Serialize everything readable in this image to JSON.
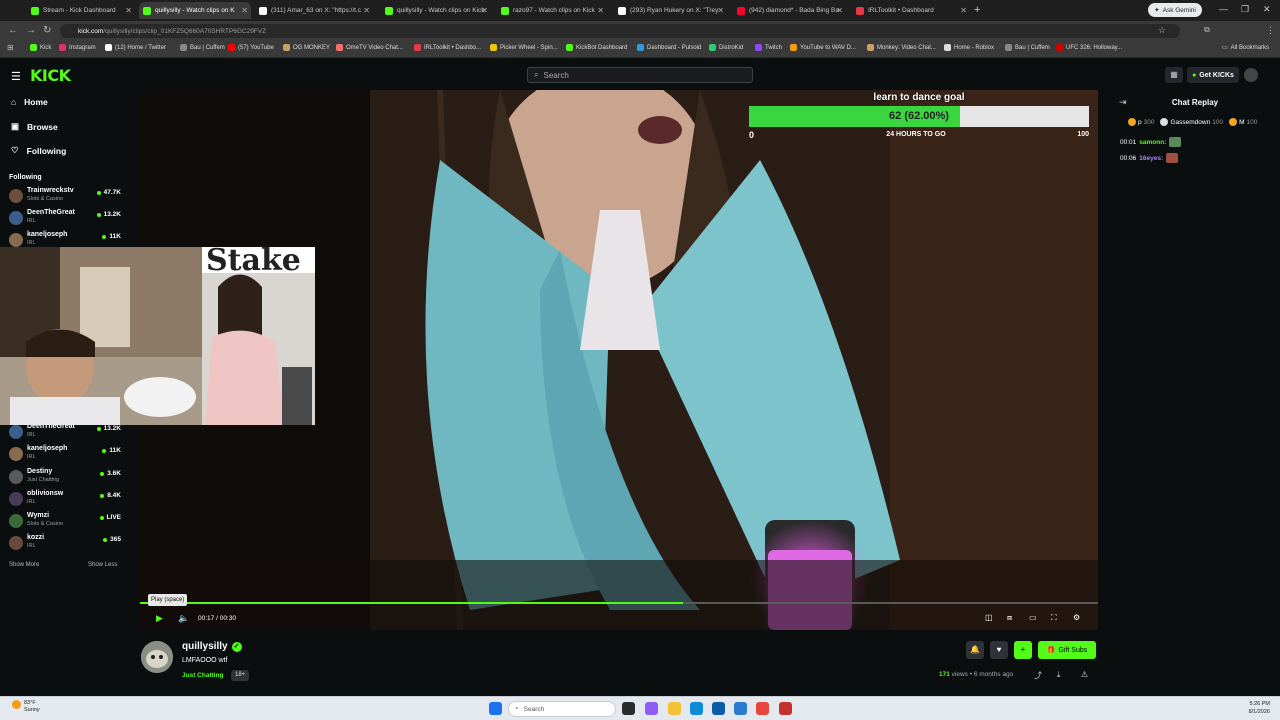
{
  "browser": {
    "tabs": [
      {
        "title": "Stream - Kick Dashboard",
        "fav_color": "#53fc18"
      },
      {
        "title": "quillysilly - Watch clips on K",
        "fav_color": "#53fc18",
        "active": true
      },
      {
        "title": "(311) Amar_63 on X: \"https://t.c",
        "fav_color": "#ffffff"
      },
      {
        "title": "quillysilly - Watch clips on Kick",
        "fav_color": "#53fc18"
      },
      {
        "title": "razo97 - Watch clips on Kick",
        "fav_color": "#53fc18"
      },
      {
        "title": "(293) Ryan Hukery on X: \"Trey",
        "fav_color": "#ffffff"
      },
      {
        "title": "(942) diamond* - Bada Bing Ba",
        "fav_color": "#ff0033"
      },
      {
        "title": "IRLToolkit • Dashboard",
        "fav_color": "#e63946"
      }
    ],
    "new_tab_label": "+",
    "gemini_label": "Ask Gemini",
    "url_domain": "kick.com",
    "url_path": "/quillysilly/clips/clip_01KFZ5Q660A70SHRTP6GC29FVZ",
    "bookmarks": [
      {
        "label": "Kick",
        "color": "#53fc18"
      },
      {
        "label": "Instagram",
        "color": "#e1306c"
      },
      {
        "label": "(12) Home / Twitter",
        "color": "#ffffff"
      },
      {
        "label": "Bau | Cuffem",
        "color": "#888888"
      },
      {
        "label": "(57) YouTube",
        "color": "#ff0000"
      },
      {
        "label": "OG MONKEY",
        "color": "#c8a165"
      },
      {
        "label": "OmeTV Video Chat...",
        "color": "#ff6b6b"
      },
      {
        "label": "IRLToolkit • Dashbo...",
        "color": "#e63946"
      },
      {
        "label": "Picker Wheel - Spin...",
        "color": "#f1c40f"
      },
      {
        "label": "KickBot Dashboard",
        "color": "#53fc18"
      },
      {
        "label": "Dashboard - Pulsoid",
        "color": "#3498db"
      },
      {
        "label": "DistroKid",
        "color": "#2ecc71"
      },
      {
        "label": "Twitch",
        "color": "#9146ff"
      },
      {
        "label": "YouTube to WAV D...",
        "color": "#f39c12"
      },
      {
        "label": "Monkey: Video Chat...",
        "color": "#c8a165"
      },
      {
        "label": "Home - Roblox",
        "color": "#dddddd"
      },
      {
        "label": "Bau | Cuffem",
        "color": "#888888"
      },
      {
        "label": "UFC 326: Holloway...",
        "color": "#d00000"
      }
    ],
    "all_bookmarks_label": "All Bookmarks"
  },
  "kick": {
    "logo": "KICK",
    "search_placeholder": "Search",
    "get_kicks_label": "Get KICKs",
    "nav": [
      {
        "label": "Home",
        "icon": "home-icon",
        "glyph": "⌂"
      },
      {
        "label": "Browse",
        "icon": "browse-icon",
        "glyph": "▣"
      },
      {
        "label": "Following",
        "icon": "heart-icon",
        "glyph": "♡"
      }
    ],
    "following_header": "Following",
    "following": [
      {
        "name": "Trainwreckstv",
        "category": "Slots & Casino",
        "viewers": "47.7K",
        "color": "#6b4f3a"
      },
      {
        "name": "DeenTheGreat",
        "category": "IRL",
        "viewers": "13.2K",
        "color": "#3a5f8a"
      },
      {
        "name": "kaneljoseph",
        "category": "IRL",
        "viewers": "11K",
        "color": "#8a6a4f"
      },
      {
        "name": "DeenTheGreat",
        "category": "IRL",
        "viewers": "13.2K",
        "color": "#3a5f8a"
      },
      {
        "name": "kaneljoseph",
        "category": "IRL",
        "viewers": "11K",
        "color": "#8a6a4f"
      },
      {
        "name": "Destiny",
        "category": "Just Chatting",
        "viewers": "3.6K",
        "color": "#5a5a5a"
      },
      {
        "name": "oblivionsw",
        "category": "IRL",
        "viewers": "8.4K",
        "color": "#4a3a5a"
      },
      {
        "name": "Wymzi",
        "category": "Slots & Casino",
        "viewers": "LIVE",
        "color": "#3a6a3a"
      },
      {
        "name": "kozzi",
        "category": "IRL",
        "viewers": "365",
        "color": "#6a4a3a"
      }
    ],
    "show_more": "Show More",
    "show_less": "Show Less"
  },
  "goal": {
    "title": "learn to dance goal",
    "progress_text": "62 (62.00%)",
    "progress": 0.62,
    "min": "0",
    "max": "100",
    "time_left": "24 HOURS TO GO"
  },
  "player": {
    "tooltip": "Play (space)",
    "current_time": "00:17",
    "duration": "00:30",
    "progress": 0.5667
  },
  "clip": {
    "streamer": "quillysilly",
    "title": "LMFAOOO wtf",
    "category": "Just Chatting",
    "age_badge": "18+",
    "gift_subs_label": "Gift Subs",
    "views": "171",
    "views_suffix": "views • 6 months ago"
  },
  "chat": {
    "title": "Chat Replay",
    "leaderboard": [
      {
        "name": "p",
        "points": "300",
        "color": "#f5a623"
      },
      {
        "name": "Gassemdown",
        "points": "100",
        "color": "#dddddd"
      },
      {
        "name": "M",
        "points": "100",
        "color": "#f5a623"
      }
    ],
    "messages": [
      {
        "time": "00:01",
        "user": "samonn:",
        "color": "#53fc18",
        "emote_color": "#5a8a5a"
      },
      {
        "time": "00:06",
        "user": "16eyes:",
        "color": "#b084ff",
        "emote_color": "#a05040"
      }
    ]
  },
  "taskbar": {
    "temp": "83°F",
    "condition": "Sunny",
    "search_placeholder": "Search",
    "time": "5:26 PM",
    "date": "8/1/2026"
  }
}
